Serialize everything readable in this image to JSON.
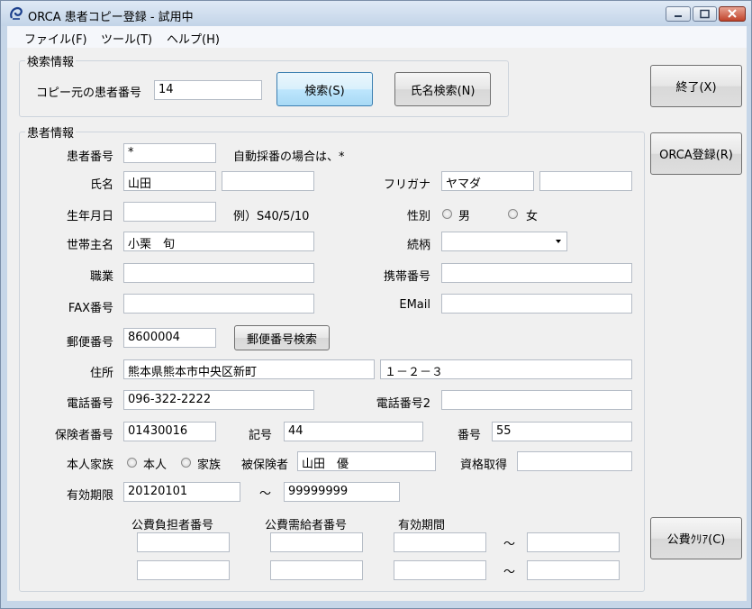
{
  "window": {
    "title": "ORCA 患者コピー登録 - 試用中",
    "accent": "#3c7fb1"
  },
  "menu": [
    "ファイル(F)",
    "ツール(T)",
    "ヘルプ(H)"
  ],
  "search": {
    "legend": "検索情報",
    "copy_label": "コピー元の患者番号",
    "copy_value": "14",
    "search_button": "検索(S)",
    "name_search_button": "氏名検索(N)"
  },
  "side_buttons": {
    "exit": "終了(X)",
    "register": "ORCA登録(R)",
    "clear": "公費ｸﾘｱ(C)"
  },
  "patient": {
    "legend": "患者情報",
    "patient_no": {
      "label": "患者番号",
      "value": "*",
      "note": "自動採番の場合は、*"
    },
    "name": {
      "label": "氏名",
      "value1": "山田",
      "value2": ""
    },
    "kana": {
      "label": "フリガナ",
      "value1": "ヤマダ",
      "value2": ""
    },
    "birth": {
      "label": "生年月日",
      "value": "",
      "example": "例）S40/5/10"
    },
    "sex": {
      "label": "性別",
      "male": "男",
      "female": "女"
    },
    "householder": {
      "label": "世帯主名",
      "value": "小栗　旬"
    },
    "relation": {
      "label": "続柄",
      "value": ""
    },
    "job": {
      "label": "職業",
      "value": ""
    },
    "mobile": {
      "label": "携帯番号",
      "value": ""
    },
    "fax": {
      "label": "FAX番号",
      "value": ""
    },
    "email": {
      "label": "EMail",
      "value": ""
    },
    "postal": {
      "label": "郵便番号",
      "value": "8600004",
      "button": "郵便番号検索"
    },
    "address": {
      "label": "住所",
      "value1": "熊本県熊本市中央区新町",
      "value2": "１－２－３"
    },
    "phone": {
      "label": "電話番号",
      "value": "096-322-2222"
    },
    "phone2": {
      "label": "電話番号2",
      "value": ""
    },
    "insurer_no": {
      "label": "保険者番号",
      "value": "01430016"
    },
    "symbol": {
      "label": "記号",
      "value": "44"
    },
    "number": {
      "label": "番号",
      "value": "55"
    },
    "family": {
      "label": "本人家族",
      "self": "本人",
      "family": "家族"
    },
    "insured": {
      "label": "被保険者",
      "value": "山田　優"
    },
    "qualification": {
      "label": "資格取得",
      "value": ""
    },
    "validity": {
      "label": "有効期限",
      "from": "20120101",
      "tilde": "～",
      "to": "99999999"
    },
    "public": {
      "col1": "公費負担者番号",
      "col2": "公費需給者番号",
      "col3": "有効期間",
      "tilde": "～"
    }
  }
}
